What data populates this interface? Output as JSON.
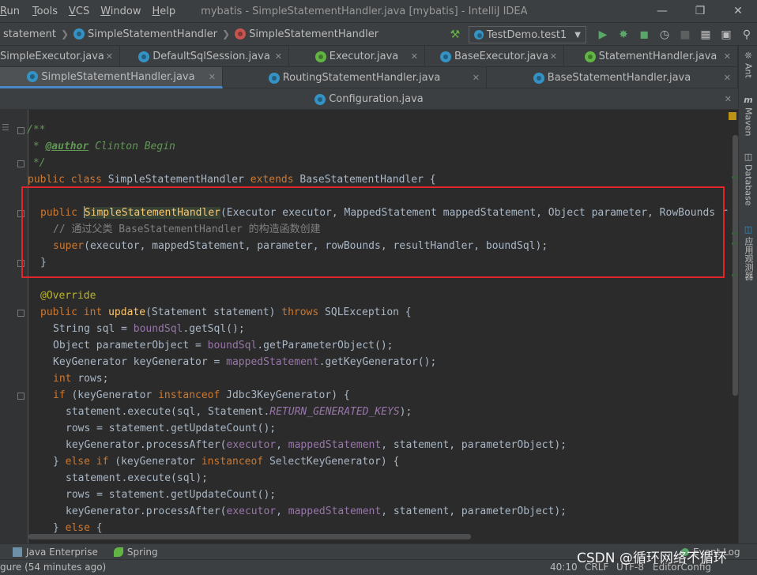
{
  "menu": {
    "items": [
      {
        "label": "Run",
        "mnemonic": "R",
        "rest": "un"
      },
      {
        "label": "Tools",
        "mnemonic": "T",
        "rest": "ools"
      },
      {
        "label": "VCS",
        "mnemonic": "V",
        "rest": "CS"
      },
      {
        "label": "Window",
        "mnemonic": "W",
        "rest": "indow"
      },
      {
        "label": "Help",
        "mnemonic": "H",
        "rest": "elp"
      }
    ],
    "window_title": "mybatis - SimpleStatementHandler.java [mybatis] - IntelliJ IDEA"
  },
  "navbar": {
    "crumbs": [
      "statement",
      "SimpleStatementHandler",
      "SimpleStatementHandler"
    ],
    "run_config": "TestDemo.test1"
  },
  "tabs": {
    "row1": [
      "SimpleExecutor.java",
      "DefaultSqlSession.java",
      "Executor.java",
      "BaseExecutor.java",
      "StatementHandler.java"
    ],
    "row2": [
      "SimpleStatementHandler.java",
      "RoutingStatementHandler.java",
      "BaseStatementHandler.java"
    ],
    "row3": [
      "Configuration.java"
    ],
    "active": "SimpleStatementHandler.java"
  },
  "right_strip": [
    "Ant",
    "Maven",
    "Database",
    "应用观测器"
  ],
  "code": {
    "l1": "/**",
    "l2_prefix": " * ",
    "l2_tag": "@author",
    "l2_name": " Clinton Begin",
    "l3": " */",
    "class_kw": "public class ",
    "class_name": "SimpleStatementHandler ",
    "extends_kw": "extends ",
    "class_rest": "BaseStatementHandler {",
    "ctor_kw": "public ",
    "ctor_name": "SimpleStatementHandler",
    "ctor_rest": "(Executor executor, MappedStatement mappedStatement, Object parameter, RowBounds r",
    "ctor_comment": "// 通过父类 BaseStatementHandler 的构造函数创建",
    "super_kw": "super",
    "super_rest": "(executor, mappedStatement, parameter, rowBounds, resultHandler, boundSql);",
    "close_brace": "}",
    "override": "@Override",
    "update_kw": "public int ",
    "update_name": "update",
    "update_mid": "(Statement statement) ",
    "throws_kw": "throws ",
    "update_rest": "SQLException {",
    "sql_decl": "String sql = ",
    "sql_field": "boundSql",
    "sql_rest": ".getSql();",
    "param_decl": "Object parameterObject = ",
    "param_field": "boundSql",
    "param_rest": ".getParameterObject();",
    "kg_decl": "KeyGenerator keyGenerator = ",
    "kg_field": "mappedStatement",
    "kg_rest": ".getKeyGenerator();",
    "int_kw": "int ",
    "rows_decl": "rows;",
    "if_kw": "if ",
    "if_mid": "(keyGenerator ",
    "instanceof_kw": "instanceof ",
    "if_rest": "Jdbc3KeyGenerator) {",
    "exec1_pre": "statement.execute(sql, Statement.",
    "exec1_const": "RETURN_GENERATED_KEYS",
    "exec1_post": ");",
    "rows1": "rows = statement.getUpdateCount();",
    "kgp_pre": "keyGenerator.processAfter(",
    "kgp_f1": "executor",
    "kgp_sep": ", ",
    "kgp_f2": "mappedStatement",
    "kgp_post": ", statement, parameterObject);",
    "else_if_pre": "} ",
    "else_if_kw": "else if ",
    "else_if_mid": "(keyGenerator ",
    "else_if_rest": "SelectKeyGenerator) {",
    "exec2": "statement.execute(sql);",
    "else_kw": "else ",
    "else_rest": "{"
  },
  "bottom_tools": [
    "Java Enterprise",
    "Spring"
  ],
  "status": {
    "message": "gure (54 minutes ago)",
    "position": "40:10",
    "line_sep": "CRLF",
    "encoding": "UTF-8",
    "editor_config": "EditorConfig",
    "event_log": "Event Log"
  },
  "watermark": "CSDN @循环网络不循环",
  "colors": {
    "highlight_box": "#e0262b",
    "active_tab_underline": "#4a88c7"
  }
}
